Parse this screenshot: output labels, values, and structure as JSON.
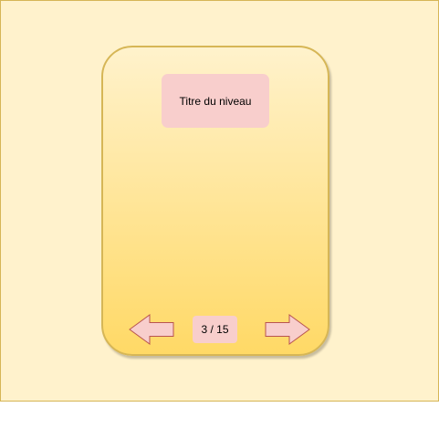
{
  "level": {
    "title": "Titre du niveau"
  },
  "pagination": {
    "indicator": "3 / 15",
    "prev_icon": "arrow-left-icon",
    "next_icon": "arrow-right-icon"
  },
  "colors": {
    "background_fill": "#fff2cc",
    "background_stroke": "#d6b656",
    "card_gradient_top": "#fff2cc",
    "card_gradient_bottom": "#ffd966",
    "box_fill": "#f8cecc",
    "arrow_stroke": "#b85450"
  }
}
